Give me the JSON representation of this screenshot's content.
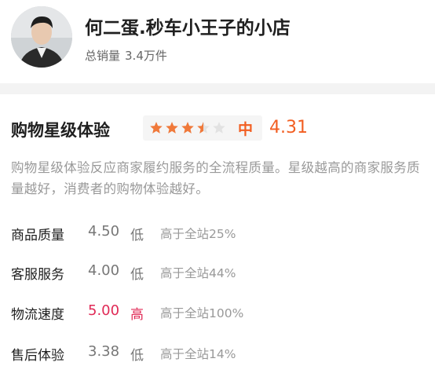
{
  "shop": {
    "name": "何二蛋.秒车小王子的小店",
    "sales_label": "总销量",
    "sales_value": "3.4万件"
  },
  "rating": {
    "title": "购物星级体验",
    "stars": 3.5,
    "level": "中",
    "score": "4.31",
    "description": "购物星级体验反应商家履约服务的全流程质量。星级越高的商家服务质量越好，消费者的购物体验越好。",
    "star_color": "#f0793a",
    "star_empty_color": "#e2e2e2"
  },
  "metrics": [
    {
      "label": "商品质量",
      "score": "4.50",
      "level": "低",
      "compare": "高于全站25%"
    },
    {
      "label": "客服服务",
      "score": "4.00",
      "level": "低",
      "compare": "高于全站44%"
    },
    {
      "label": "物流速度",
      "score": "5.00",
      "level": "高",
      "compare": "高于全站100%"
    },
    {
      "label": "售后体验",
      "score": "3.38",
      "level": "低",
      "compare": "高于全站14%"
    }
  ]
}
